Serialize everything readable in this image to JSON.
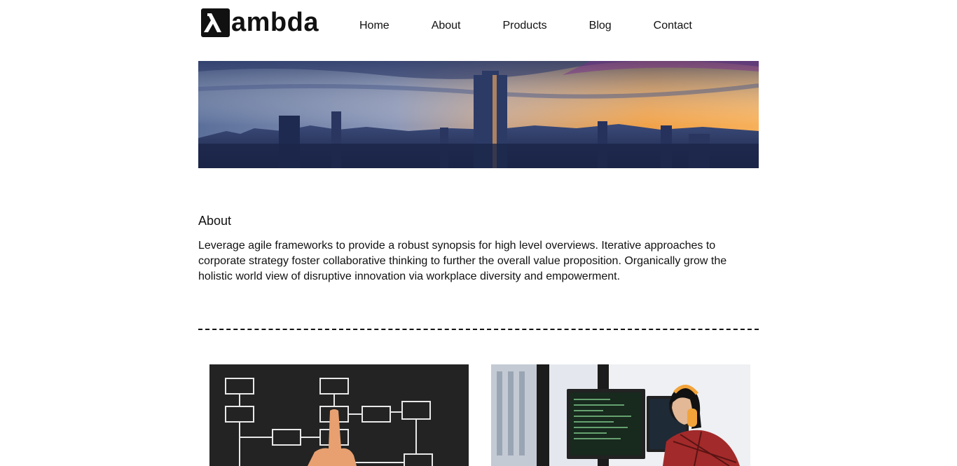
{
  "brand": {
    "name": "ambda",
    "logo_icon": "lambda-icon"
  },
  "nav": {
    "items": [
      {
        "label": "Home"
      },
      {
        "label": "About"
      },
      {
        "label": "Products"
      },
      {
        "label": "Blog"
      },
      {
        "label": "Contact"
      }
    ]
  },
  "hero": {
    "image": "city-skyline-sunset-image"
  },
  "about": {
    "title": "About",
    "text": "Leverage agile frameworks to provide a robust synopsis for high level overviews. Iterative approaches to corporate strategy foster collaborative thinking to further the overall value proposition. Organically grow the holistic world view of disruptive innovation via workplace diversity and empowerment."
  },
  "cards": [
    {
      "image": "flowchart-chalkboard-image"
    },
    {
      "image": "developer-at-monitors-image"
    }
  ],
  "colors": {
    "text": "#111111",
    "background": "#ffffff"
  }
}
